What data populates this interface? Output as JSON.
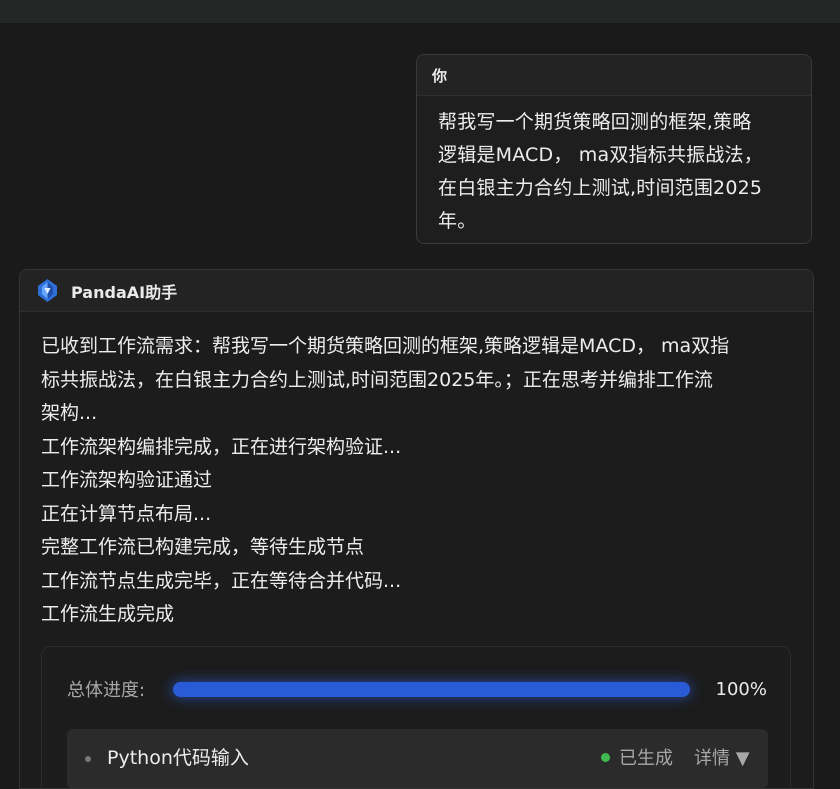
{
  "user_message": {
    "sender": "你",
    "lines": [
      "帮我写一个期货策略回测的框架,策略",
      "逻辑是MACD， ma双指标共振战法，",
      "在白银主力合约上测试,时间范围2025",
      "年。"
    ]
  },
  "assistant_message": {
    "sender": "PandaAI助手",
    "lines": [
      "已收到工作流需求：帮我写一个期货策略回测的框架,策略逻辑是MACD， ma双指",
      "标共振战法，在白银主力合约上测试,时间范围2025年。；正在思考并编排工作流",
      "架构...",
      "工作流架构编排完成，正在进行架构验证...",
      "工作流架构验证通过",
      "正在计算节点布局...",
      "完整工作流已构建完成，等待生成节点",
      "工作流节点生成完毕，正在等待合并代码...",
      "工作流生成完成"
    ],
    "progress": {
      "label": "总体进度:",
      "value": 1.0,
      "percent_text": "100%"
    },
    "node": {
      "name": "Python代码输入",
      "status": "已生成",
      "details_label": "详情 ▼"
    }
  },
  "colors": {
    "background": "#1a1a1a",
    "progress_fill": "#2a5bd6",
    "status_ok": "#3fb950"
  },
  "icons": {
    "assistant_avatar": "panda-ai-logo-icon"
  }
}
